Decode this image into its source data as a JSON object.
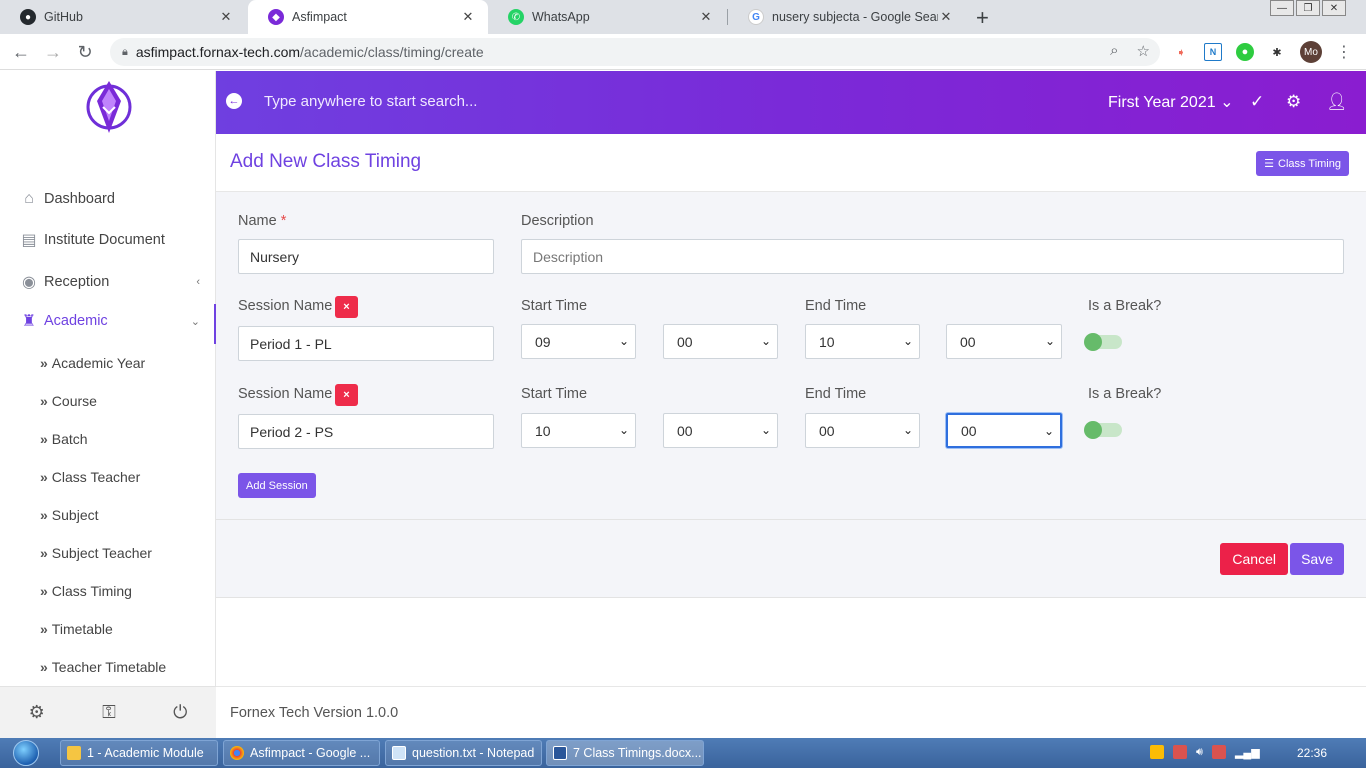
{
  "browser": {
    "tabs": [
      {
        "title": "GitHub",
        "icon": "github-icon"
      },
      {
        "title": "Asfimpact",
        "icon": "asfimpact-icon"
      },
      {
        "title": "WhatsApp",
        "icon": "whatsapp-icon"
      },
      {
        "title": "nusery subjecta - Google Search",
        "icon": "google-icon"
      }
    ],
    "url_host": "asfimpact.fornax-tech.com",
    "url_path": "/academic/class/timing/create",
    "profile_initials": "Mo"
  },
  "sidebar": {
    "items": [
      {
        "label": "Dashboard",
        "icon": "home-icon"
      },
      {
        "label": "Institute Document",
        "icon": "document-icon"
      },
      {
        "label": "Reception",
        "icon": "user-icon"
      },
      {
        "label": "Academic",
        "icon": "academic-icon"
      }
    ],
    "academic_sub": [
      "Academic Year",
      "Course",
      "Batch",
      "Class Teacher",
      "Subject",
      "Subject Teacher",
      "Class Timing",
      "Timetable",
      "Teacher Timetable"
    ],
    "sub_prefix": "»"
  },
  "header": {
    "search_placeholder": "Type anywhere to start search...",
    "academic_year": "First Year 2021"
  },
  "page": {
    "title": "Add New Class Timing",
    "list_button": "Class Timing"
  },
  "form": {
    "name_label": "Name",
    "name_required": "*",
    "name_value": "Nursery",
    "description_label": "Description",
    "description_placeholder": "Description",
    "session_label": "Session Name",
    "start_label": "Start Time",
    "end_label": "End Time",
    "break_label": "Is a Break?",
    "sessions": [
      {
        "name": "Period 1 - PL",
        "start_hour": "09",
        "start_min": "00",
        "end_hour": "10",
        "end_min": "00",
        "is_break": false
      },
      {
        "name": "Period 2 - PS",
        "start_hour": "10",
        "start_min": "00",
        "end_hour": "00",
        "end_min": "00",
        "is_break": false
      }
    ],
    "remove_symbol": "×",
    "add_session": "Add Session",
    "cancel": "Cancel",
    "save": "Save"
  },
  "footer": {
    "text": "Fornex Tech Version 1.0.0"
  },
  "taskbar": {
    "items": [
      "1 - Academic Module",
      "Asfimpact - Google ...",
      "question.txt - Notepad",
      "7 Class Timings.docx..."
    ],
    "clock": "22:36"
  },
  "colors": {
    "accent": "#6f42e1",
    "danger": "#ec2149",
    "toggle_on": "#66bb6a"
  }
}
